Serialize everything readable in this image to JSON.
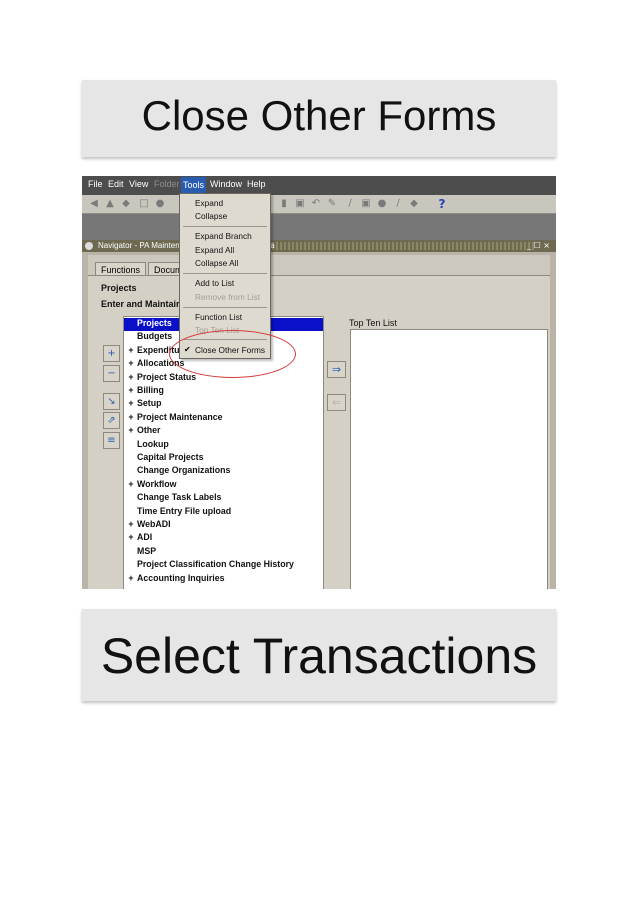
{
  "banners": {
    "top": "Close Other Forms",
    "bottom": "Select Transactions"
  },
  "menubar": {
    "items": [
      "File",
      "Edit",
      "View",
      "Folder",
      "Tools",
      "Window",
      "Help"
    ]
  },
  "titlebar": {
    "title": "Navigator - PA Mainten",
    "fragment": "a",
    "controls": "_ ☐ ×"
  },
  "tabs": [
    "Functions",
    "Docum"
  ],
  "labels": {
    "projects": "Projects",
    "enter_maintain": "Enter and Maintair",
    "top_ten_list": "Top Ten List"
  },
  "tools_menu": {
    "expand": "Expand",
    "collapse": "Collapse",
    "expand_branch": "Expand Branch",
    "expand_all": "Expand All",
    "collapse_all": "Collapse All",
    "add_to_list": "Add to List",
    "remove_from_list": "Remove from List",
    "function_list": "Function List",
    "top_ten_list": "Top Ten List",
    "close_other_forms": "Close Other Forms"
  },
  "tree_items": [
    {
      "label": "Projects",
      "expandable": false,
      "selected": true
    },
    {
      "label": "Budgets",
      "expandable": false,
      "selected": false
    },
    {
      "label": "Expenditu",
      "expandable": true,
      "selected": false
    },
    {
      "label": "Allocations",
      "expandable": true,
      "selected": false
    },
    {
      "label": "Project Status",
      "expandable": true,
      "selected": false
    },
    {
      "label": "Billing",
      "expandable": true,
      "selected": false
    },
    {
      "label": "Setup",
      "expandable": true,
      "selected": false
    },
    {
      "label": "Project Maintenance",
      "expandable": true,
      "selected": false
    },
    {
      "label": "Other",
      "expandable": true,
      "selected": false
    },
    {
      "label": "Lookup",
      "expandable": false,
      "selected": false
    },
    {
      "label": "Capital Projects",
      "expandable": false,
      "selected": false
    },
    {
      "label": "Change Organizations",
      "expandable": false,
      "selected": false
    },
    {
      "label": "Workflow",
      "expandable": true,
      "selected": false
    },
    {
      "label": "Change Task Labels",
      "expandable": false,
      "selected": false
    },
    {
      "label": "Time Entry File upload",
      "expandable": false,
      "selected": false
    },
    {
      "label": "WebADI",
      "expandable": true,
      "selected": false
    },
    {
      "label": "ADI",
      "expandable": true,
      "selected": false
    },
    {
      "label": "MSP",
      "expandable": false,
      "selected": false
    },
    {
      "label": "Project Classification Change History",
      "expandable": false,
      "selected": false
    },
    {
      "label": "Accounting Inquiries",
      "expandable": true,
      "selected": false
    }
  ],
  "glyphs": {
    "plus": "+",
    "check": "✔",
    "help": "?",
    "right_arrow": "⇒",
    "left_arrow": "⇐"
  }
}
